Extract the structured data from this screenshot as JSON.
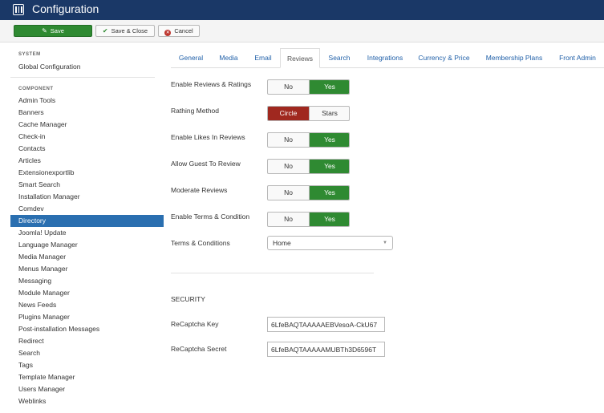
{
  "header": {
    "title": "Configuration",
    "icon": "settings-grid-icon"
  },
  "toolbar": {
    "save_label": "Save",
    "save_close_label": "Save & Close",
    "cancel_label": "Cancel"
  },
  "sidebar": {
    "system_heading": "SYSTEM",
    "global_config": "Global Configuration",
    "component_heading": "COMPONENT",
    "items": [
      "Admin Tools",
      "Banners",
      "Cache Manager",
      "Check-in",
      "Contacts",
      "Articles",
      "Extensionexportlib",
      "Smart Search",
      "Installation Manager",
      "Comdev",
      "Directory",
      "Joomla! Update",
      "Language Manager",
      "Media Manager",
      "Menus Manager",
      "Messaging",
      "Module Manager",
      "News Feeds",
      "Plugins Manager",
      "Post-installation Messages",
      "Redirect",
      "Search",
      "Tags",
      "Template Manager",
      "Users Manager",
      "Weblinks"
    ],
    "active_item": "Directory"
  },
  "tabs": [
    "General",
    "Media",
    "Email",
    "Reviews",
    "Search",
    "Integrations",
    "Currency & Price",
    "Membership Plans",
    "Front Admin"
  ],
  "active_tab": "Reviews",
  "fields": {
    "enable_reviews": {
      "label": "Enable Reviews & Ratings",
      "left": "No",
      "right": "Yes",
      "selected": "Yes"
    },
    "rating_method": {
      "label": "Rathing Method",
      "left": "Circle",
      "right": "Stars",
      "selected": "Circle"
    },
    "enable_likes": {
      "label": "Enable Likes In Reviews",
      "left": "No",
      "right": "Yes",
      "selected": "Yes"
    },
    "allow_guest": {
      "label": "Allow Guest To Review",
      "left": "No",
      "right": "Yes",
      "selected": "Yes"
    },
    "moderate": {
      "label": "Moderate Reviews",
      "left": "No",
      "right": "Yes",
      "selected": "Yes"
    },
    "enable_terms": {
      "label": "Enable Terms & Condition",
      "left": "No",
      "right": "Yes",
      "selected": "Yes"
    },
    "terms": {
      "label": "Terms & Conditions",
      "value": "Home"
    }
  },
  "security": {
    "heading": "SECURITY",
    "recaptcha_key": {
      "label": "ReCaptcha Key",
      "value": "6LfeBAQTAAAAAEBVesoA-CkU67"
    },
    "recaptcha_secret": {
      "label": "ReCaptcha Secret",
      "value": "6LfeBAQTAAAAAMUBTh3D6596T"
    }
  },
  "colors": {
    "header": "#1a3867",
    "save": "#2f8a32",
    "active_green": "#2f8a32",
    "active_red": "#a0281f",
    "sidebar_active": "#2a6fb0",
    "link": "#1f5fa8"
  }
}
